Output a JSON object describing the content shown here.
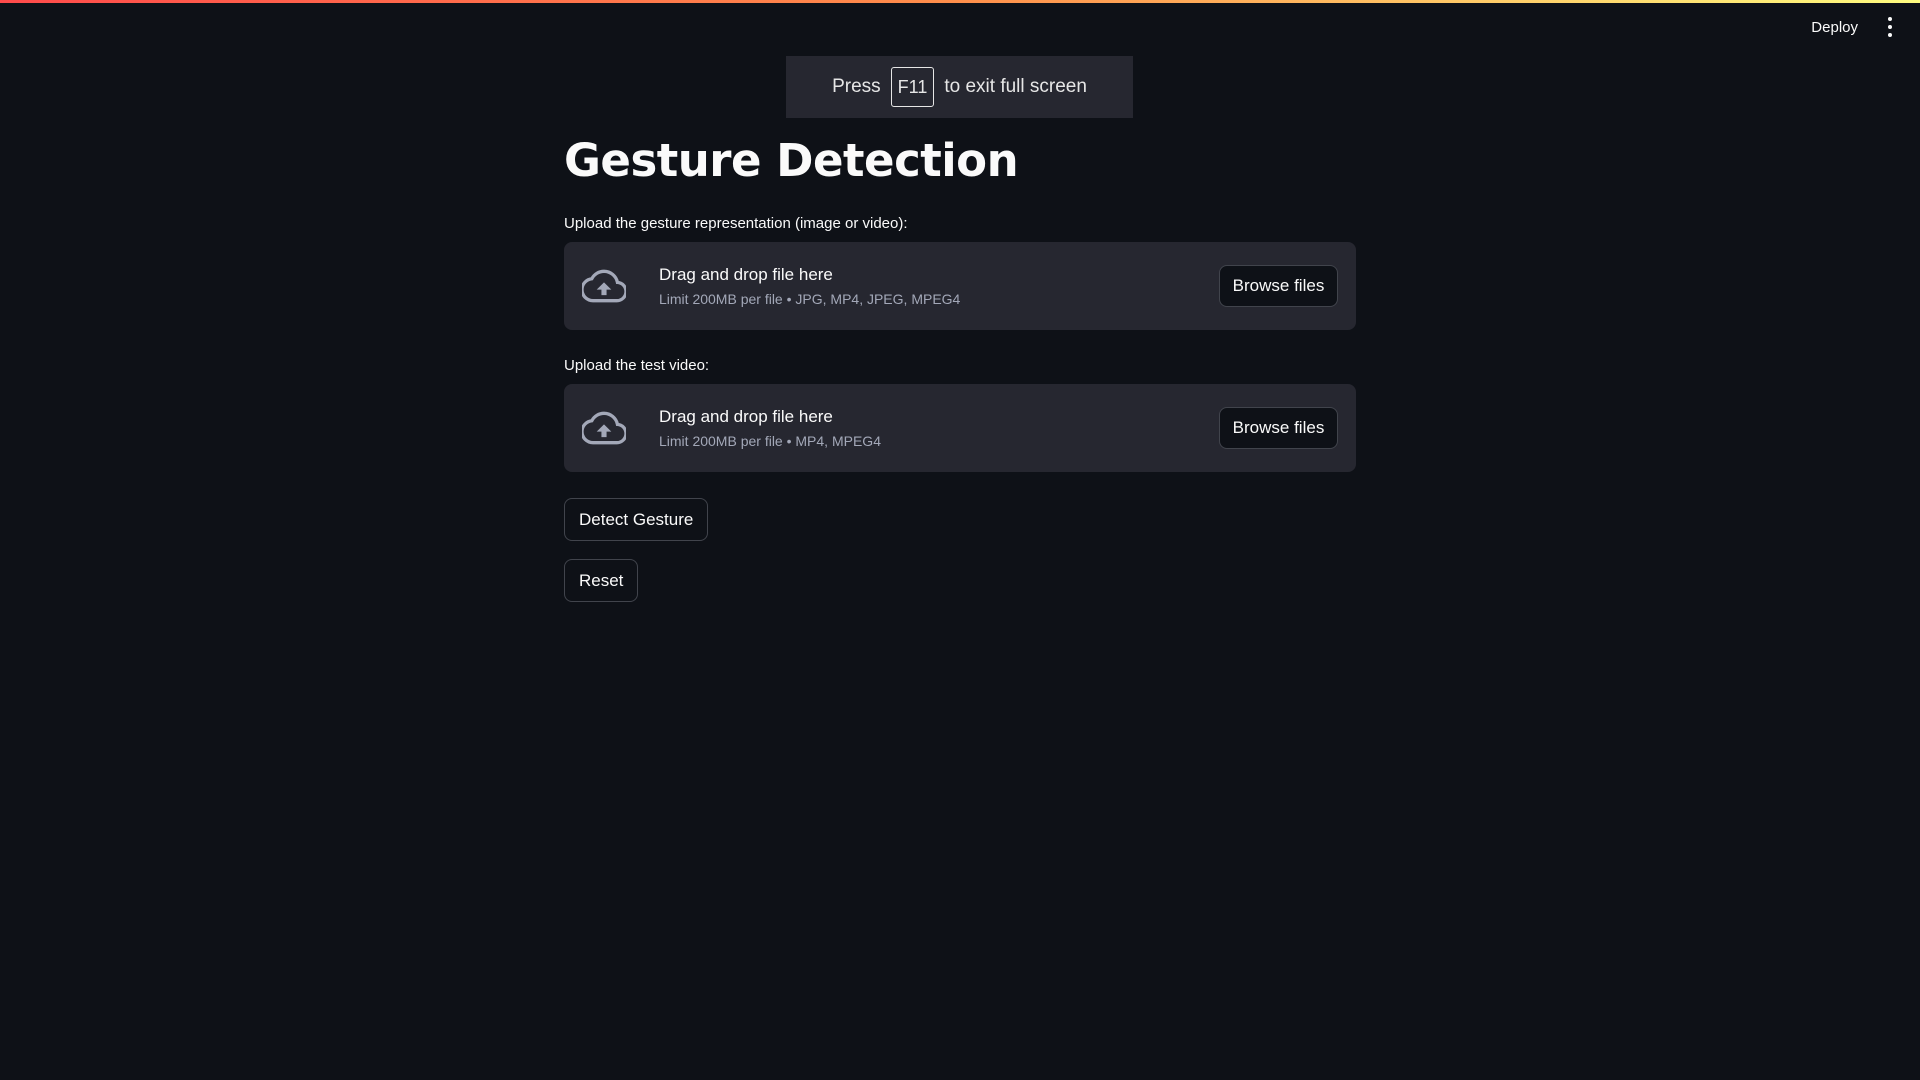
{
  "header": {
    "deploy_label": "Deploy",
    "menu_icon": "more-vertical-icon"
  },
  "toast": {
    "before": "Press",
    "key": "F11",
    "after": "to exit full screen"
  },
  "page": {
    "title": "Gesture Detection"
  },
  "uploaders": [
    {
      "label": "Upload the gesture representation (image or video):",
      "drop_text": "Drag and drop file here",
      "limit_text": "Limit 200MB per file • JPG, MP4, JPEG, MPEG4",
      "button_label": "Browse files",
      "icon": "cloud-upload-icon"
    },
    {
      "label": "Upload the test video:",
      "drop_text": "Drag and drop file here",
      "limit_text": "Limit 200MB per file • MP4, MPEG4",
      "button_label": "Browse files",
      "icon": "cloud-upload-icon"
    }
  ],
  "buttons": {
    "detect_label": "Detect Gesture",
    "reset_label": "Reset"
  },
  "colors": {
    "background": "#0e1117",
    "surface": "#262730",
    "accent_gradient_start": "#ff4b4b",
    "accent_gradient_end": "#fffd80"
  }
}
